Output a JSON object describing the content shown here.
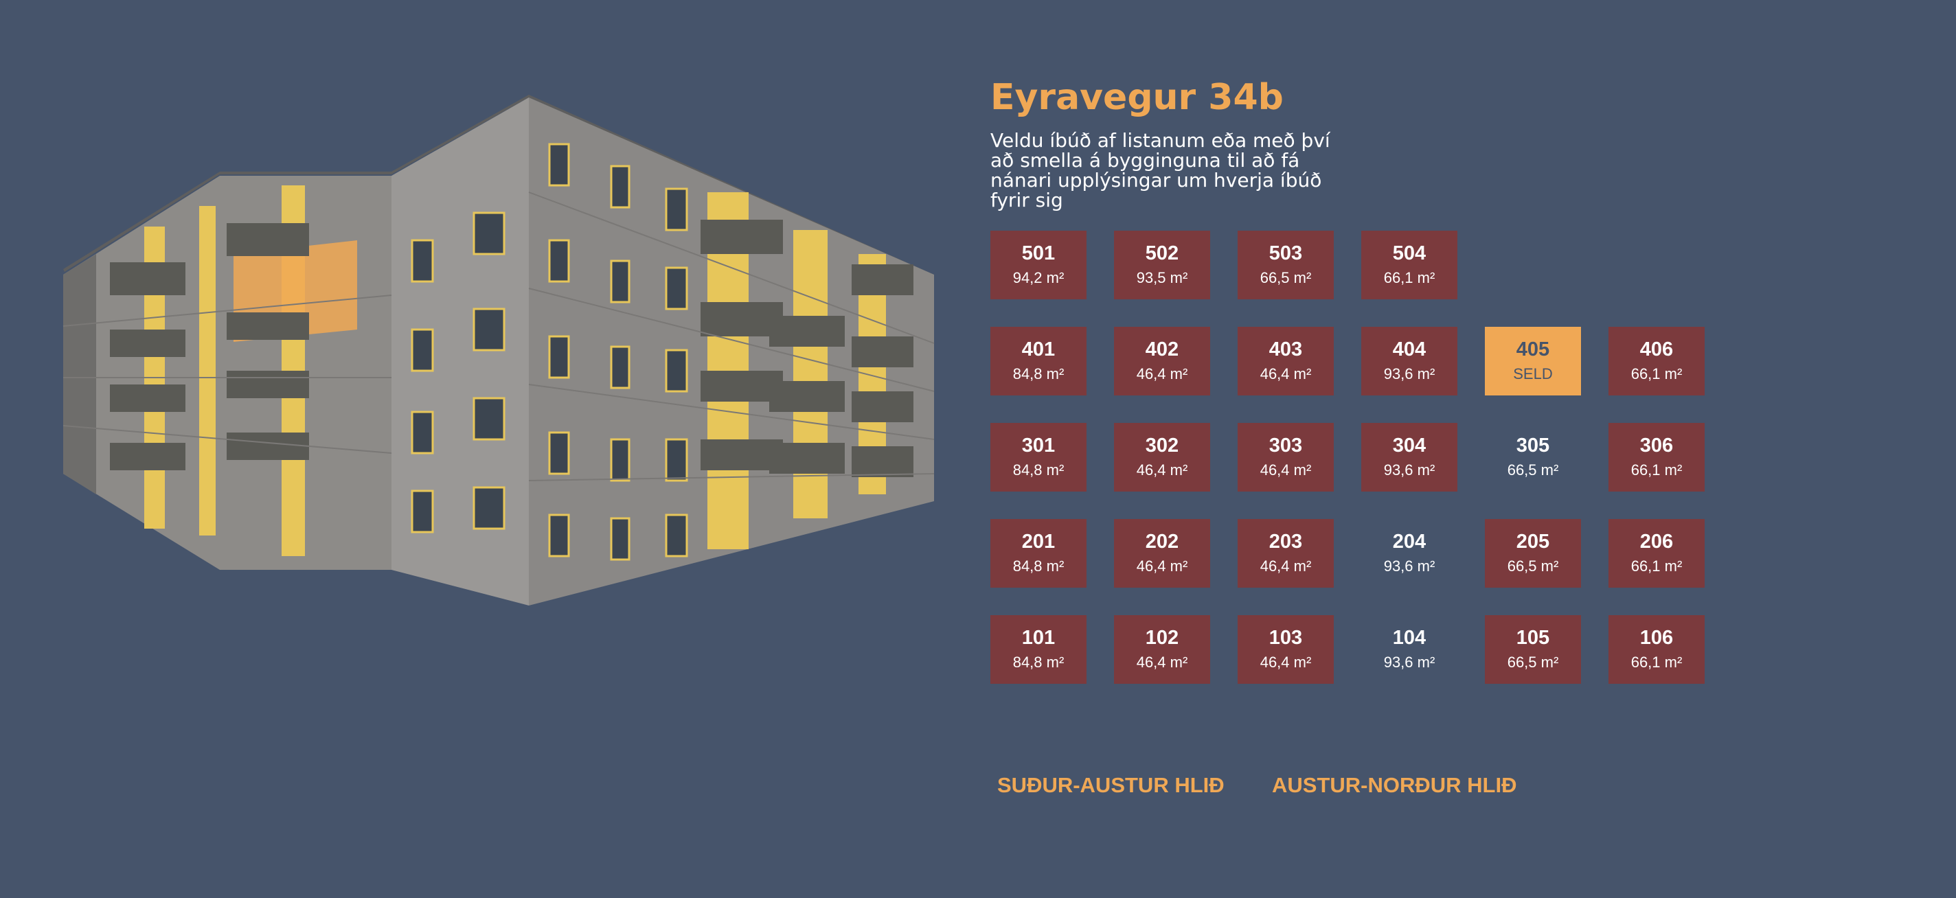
{
  "building": {
    "title": "Eyravegur 34b",
    "subtitle": "Veldu íbúð af listanum eða með því að smella á bygginguna til að fá nánari upplýsingar um hverja íbúð fyrir sig"
  },
  "colors": {
    "background": "#46546b",
    "accent": "#f0a855",
    "available": "#7b3a3d",
    "sold": "#f0a855"
  },
  "floors": [
    {
      "units": [
        {
          "number": "501",
          "size": "94,2 m²",
          "status": "available"
        },
        {
          "number": "502",
          "size": "93,5 m²",
          "status": "available"
        },
        {
          "number": "503",
          "size": "66,5 m²",
          "status": "available"
        },
        {
          "number": "504",
          "size": "66,1 m²",
          "status": "available"
        },
        null,
        null
      ]
    },
    {
      "units": [
        {
          "number": "401",
          "size": "84,8 m²",
          "status": "available"
        },
        {
          "number": "402",
          "size": "46,4 m²",
          "status": "available"
        },
        {
          "number": "403",
          "size": "46,4 m²",
          "status": "available"
        },
        {
          "number": "404",
          "size": "93,6 m²",
          "status": "available"
        },
        {
          "number": "405",
          "size": "SELD",
          "status": "sold"
        },
        {
          "number": "406",
          "size": "66,1 m²",
          "status": "available"
        }
      ]
    },
    {
      "units": [
        {
          "number": "301",
          "size": "84,8 m²",
          "status": "available"
        },
        {
          "number": "302",
          "size": "46,4 m²",
          "status": "available"
        },
        {
          "number": "303",
          "size": "46,4 m²",
          "status": "available"
        },
        {
          "number": "304",
          "size": "93,6 m²",
          "status": "available"
        },
        {
          "number": "305",
          "size": "66,5 m²",
          "status": "reserved"
        },
        {
          "number": "306",
          "size": "66,1 m²",
          "status": "available"
        }
      ]
    },
    {
      "units": [
        {
          "number": "201",
          "size": "84,8 m²",
          "status": "available"
        },
        {
          "number": "202",
          "size": "46,4 m²",
          "status": "available"
        },
        {
          "number": "203",
          "size": "46,4 m²",
          "status": "available"
        },
        {
          "number": "204",
          "size": "93,6 m²",
          "status": "reserved"
        },
        {
          "number": "205",
          "size": "66,5 m²",
          "status": "available"
        },
        {
          "number": "206",
          "size": "66,1 m²",
          "status": "available"
        }
      ]
    },
    {
      "units": [
        {
          "number": "101",
          "size": "84,8 m²",
          "status": "available"
        },
        {
          "number": "102",
          "size": "46,4 m²",
          "status": "available"
        },
        {
          "number": "103",
          "size": "46,4 m²",
          "status": "available"
        },
        {
          "number": "104",
          "size": "93,6 m²",
          "status": "reserved"
        },
        {
          "number": "105",
          "size": "66,5 m²",
          "status": "available"
        },
        {
          "number": "106",
          "size": "66,1 m²",
          "status": "available"
        }
      ]
    }
  ],
  "views": {
    "southeast": "SUÐUR-AUSTUR HLIÐ",
    "northeast": "AUSTUR-NORÐUR HLIÐ"
  }
}
